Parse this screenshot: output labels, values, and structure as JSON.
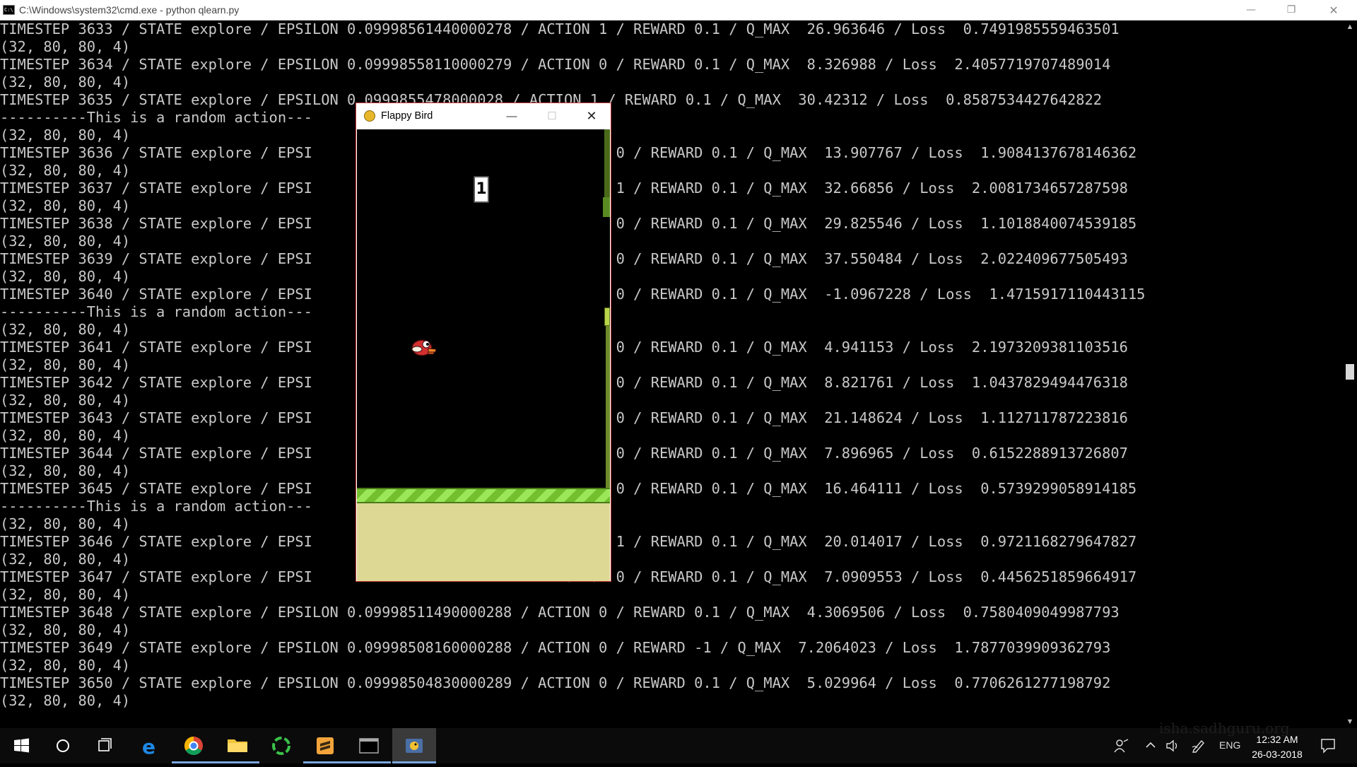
{
  "cmd": {
    "title": "C:\\Windows\\system32\\cmd.exe - python  qlearn.py",
    "icon": "cmd-icon",
    "icon_text": "C:\\",
    "minimize": "—",
    "maximize": "❐",
    "close": "✕",
    "lines": [
      "TIMESTEP 3633 / STATE explore / EPSILON 0.09998561440000278 / ACTION 1 / REWARD 0.1 / Q_MAX  26.963646 / Loss  0.7491985559463501",
      "(32, 80, 80, 4)",
      "TIMESTEP 3634 / STATE explore / EPSILON 0.09998558110000279 / ACTION 0 / REWARD 0.1 / Q_MAX  8.326988 / Loss  2.4057719707489014",
      "(32, 80, 80, 4)",
      "TIMESTEP 3635 / STATE explore / EPSILON 0.0999855478000028 / ACTION 1 / REWARD 0.1 / Q_MAX  30.42312 / Loss  0.8587534427642822",
      "----------This is a random action---",
      "(32, 80, 80, 4)",
      "TIMESTEP 3636 / STATE explore / EPSI                            ACTION 0 / REWARD 0.1 / Q_MAX  13.907767 / Loss  1.9084137678146362",
      "(32, 80, 80, 4)",
      "TIMESTEP 3637 / STATE explore / EPSI                            ACTION 1 / REWARD 0.1 / Q_MAX  32.66856 / Loss  2.0081734657287598",
      "(32, 80, 80, 4)",
      "TIMESTEP 3638 / STATE explore / EPSI                            ACTION 0 / REWARD 0.1 / Q_MAX  29.825546 / Loss  1.1018840074539185",
      "(32, 80, 80, 4)",
      "TIMESTEP 3639 / STATE explore / EPSI                            ACTION 0 / REWARD 0.1 / Q_MAX  37.550484 / Loss  2.022409677505493",
      "(32, 80, 80, 4)",
      "TIMESTEP 3640 / STATE explore / EPSI                            ACTION 0 / REWARD 0.1 / Q_MAX  -1.0967228 / Loss  1.4715917110443115",
      "----------This is a random action---",
      "(32, 80, 80, 4)",
      "TIMESTEP 3641 / STATE explore / EPSI                            ACTION 0 / REWARD 0.1 / Q_MAX  4.941153 / Loss  2.1973209381103516",
      "(32, 80, 80, 4)",
      "TIMESTEP 3642 / STATE explore / EPSI                            ACTION 0 / REWARD 0.1 / Q_MAX  8.821761 / Loss  1.0437829494476318",
      "(32, 80, 80, 4)",
      "TIMESTEP 3643 / STATE explore / EPSI                            ACTION 0 / REWARD 0.1 / Q_MAX  21.148624 / Loss  1.112711787223816",
      "(32, 80, 80, 4)",
      "TIMESTEP 3644 / STATE explore / EPSI                            ACTION 0 / REWARD 0.1 / Q_MAX  7.896965 / Loss  0.6152288913726807",
      "(32, 80, 80, 4)",
      "TIMESTEP 3645 / STATE explore / EPSI                            ACTION 0 / REWARD 0.1 / Q_MAX  16.464111 / Loss  0.5739299058914185",
      "----------This is a random action---",
      "(32, 80, 80, 4)",
      "TIMESTEP 3646 / STATE explore / EPSI                            ACTION 1 / REWARD 0.1 / Q_MAX  20.014017 / Loss  0.9721168279647827",
      "(32, 80, 80, 4)",
      "TIMESTEP 3647 / STATE explore / EPSI                            ACTION 0 / REWARD 0.1 / Q_MAX  7.0909553 / Loss  0.4456251859664917",
      "(32, 80, 80, 4)",
      "TIMESTEP 3648 / STATE explore / EPSILON 0.09998511490000288 / ACTION 0 / REWARD 0.1 / Q_MAX  4.3069506 / Loss  0.7580409049987793",
      "(32, 80, 80, 4)",
      "TIMESTEP 3649 / STATE explore / EPSILON 0.09998508160000288 / ACTION 0 / REWARD -1 / Q_MAX  7.2064023 / Loss  1.7877039909362793",
      "(32, 80, 80, 4)",
      "TIMESTEP 3650 / STATE explore / EPSILON 0.09998504830000289 / ACTION 0 / REWARD 0.1 / Q_MAX  5.029964 / Loss  0.7706261277198792",
      "(32, 80, 80, 4)"
    ]
  },
  "game": {
    "title": "Flappy Bird",
    "icon": "flappy-bird-icon",
    "minimize": "—",
    "maximize": "☐",
    "close": "✕",
    "score": "1",
    "colors": {
      "sky": "#000000",
      "ground": "#ded895",
      "grass_a": "#73bf2e",
      "grass_b": "#9be659",
      "pipe": "#6e8a2a",
      "bird": "#d32f2f"
    }
  },
  "taskbar": {
    "items": [
      {
        "icon": "windows-start-icon"
      },
      {
        "icon": "cortana-search-icon"
      },
      {
        "icon": "task-view-icon"
      },
      {
        "icon": "edge-browser-icon"
      },
      {
        "icon": "chrome-icon"
      },
      {
        "icon": "file-explorer-icon"
      },
      {
        "icon": "green-ring-app-icon"
      },
      {
        "icon": "sublime-text-icon"
      },
      {
        "icon": "command-prompt-icon"
      },
      {
        "icon": "python-pygame-icon"
      }
    ],
    "tray": {
      "language": "ENG",
      "time": "12:32 AM",
      "date": "26-03-2018"
    }
  },
  "watermark": "isha.sadhguru.org"
}
